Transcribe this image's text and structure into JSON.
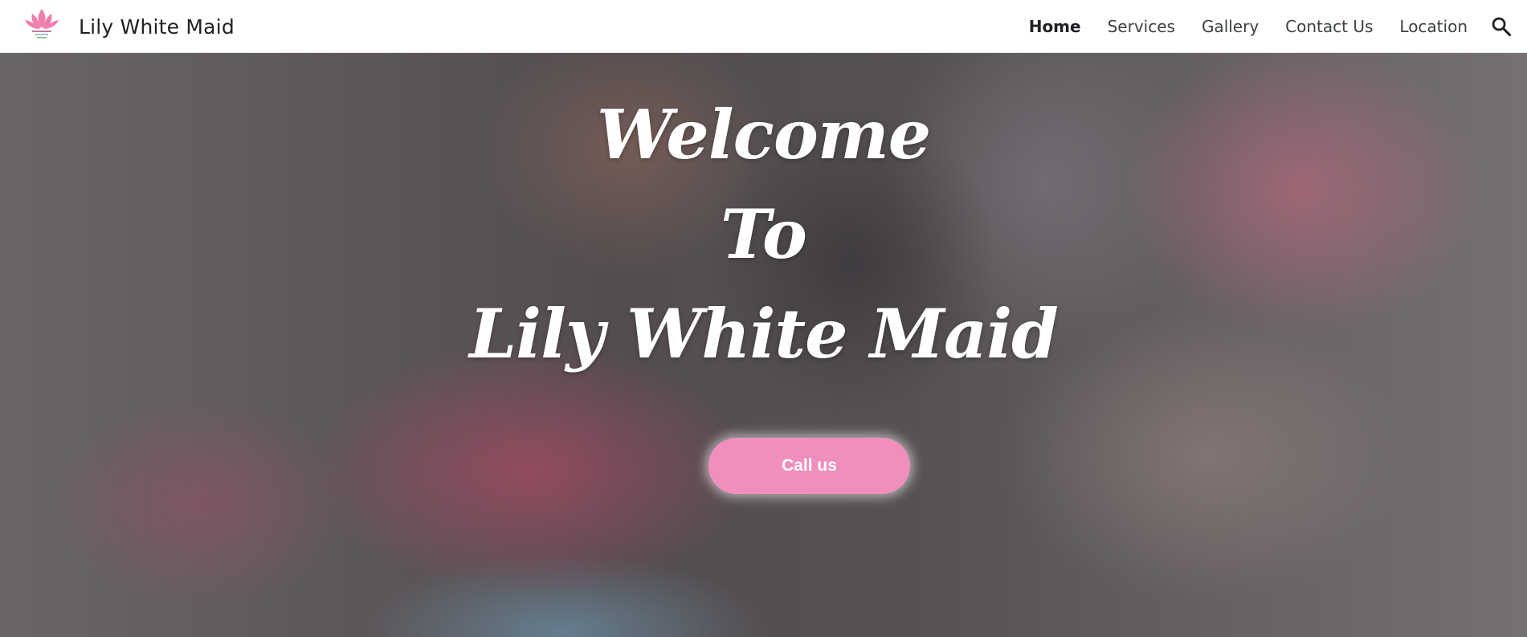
{
  "header": {
    "site_title": "Lily White Maid",
    "logo_icon": "lotus-logo-icon",
    "nav": [
      {
        "label": "Home",
        "active": true
      },
      {
        "label": "Services",
        "active": false
      },
      {
        "label": "Gallery",
        "active": false
      },
      {
        "label": "Contact Us",
        "active": false
      },
      {
        "label": "Location",
        "active": false
      }
    ],
    "search_icon": "search-icon"
  },
  "hero": {
    "title_lines": [
      "Welcome",
      "To",
      "Lily White Maid"
    ],
    "cta_label": "Call us",
    "cta_color": "#f08fbd"
  },
  "colors": {
    "accent": "#f08fbd",
    "logo_pink": "#ef7fb0",
    "logo_green": "#6cc26c"
  }
}
